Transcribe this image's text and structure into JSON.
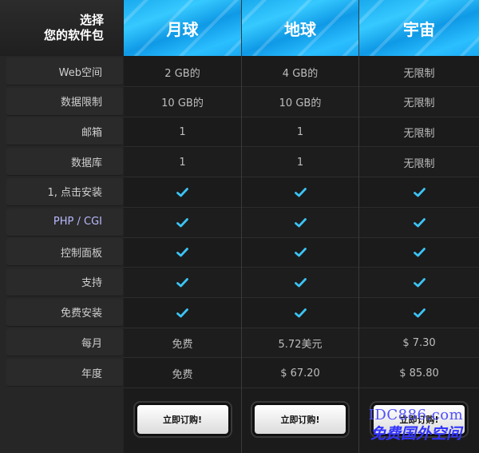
{
  "corner": {
    "line1": "选择",
    "line2": "您的软件包"
  },
  "plans": [
    {
      "name": "月球",
      "button": "立即订购!"
    },
    {
      "name": "地球",
      "button": "立即订购!"
    },
    {
      "name": "宇宙",
      "button": "立即订购!"
    }
  ],
  "rows": [
    {
      "label": "Web空间",
      "values": [
        "2 GB的",
        "4 GB的",
        "无限制"
      ]
    },
    {
      "label": "数据限制",
      "values": [
        "10 GB的",
        "10 GB的",
        "无限制"
      ]
    },
    {
      "label": "邮箱",
      "values": [
        "1",
        "1",
        "无限制"
      ]
    },
    {
      "label": "数据库",
      "values": [
        "1",
        "1",
        "无限制"
      ]
    },
    {
      "label": "1, 点击安装",
      "values": [
        "check",
        "check",
        "check"
      ]
    },
    {
      "label": "PHP / CGI",
      "values": [
        "check",
        "check",
        "check"
      ]
    },
    {
      "label": "控制面板",
      "values": [
        "check",
        "check",
        "check"
      ]
    },
    {
      "label": "支持",
      "values": [
        "check",
        "check",
        "check"
      ]
    },
    {
      "label": "免费安装",
      "values": [
        "check",
        "check",
        "check"
      ]
    },
    {
      "label": "每月",
      "values": [
        "免费",
        "5.72美元",
        "$ 7.30"
      ]
    },
    {
      "label": "年度",
      "values": [
        "免费",
        "$ 67.20",
        "$ 85.80"
      ]
    }
  ],
  "watermark": {
    "line1": "IDC886.com",
    "line2": "免费国外空间"
  },
  "colors": {
    "header_blue": "#19a9ee",
    "check": "#3cc4f5"
  }
}
